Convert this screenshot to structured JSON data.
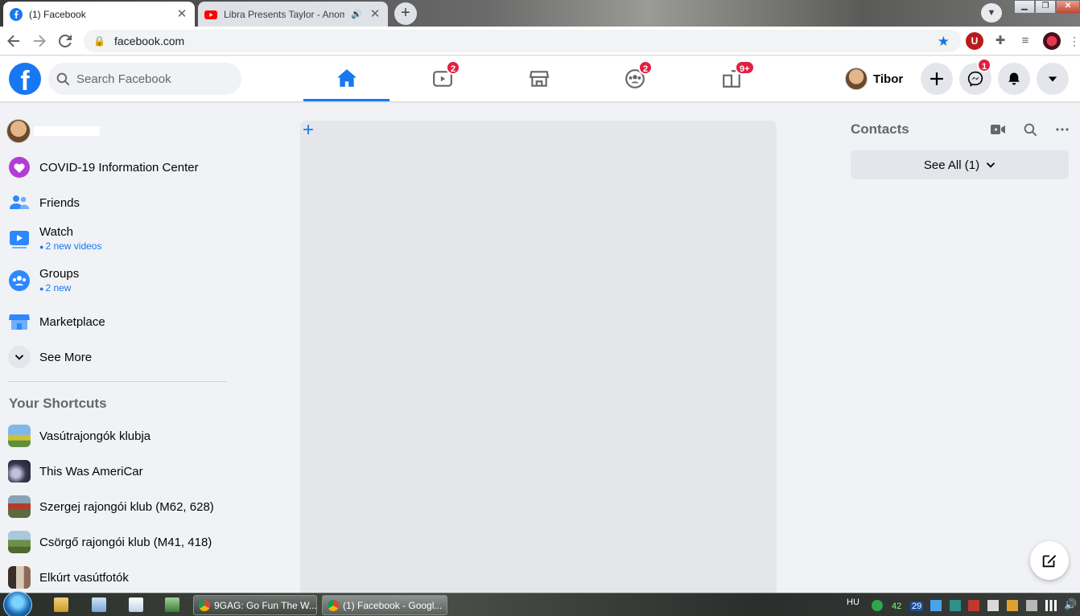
{
  "browser": {
    "tabs": [
      {
        "title": "(1) Facebook",
        "icon": "facebook-icon"
      },
      {
        "title": "Libra Presents Taylor - Anom",
        "icon": "youtube-icon"
      }
    ],
    "url": "facebook.com",
    "accent": "#1a73e8"
  },
  "header": {
    "search_placeholder": "Search Facebook",
    "nav": [
      {
        "name": "home",
        "badge": ""
      },
      {
        "name": "watch",
        "badge": "2"
      },
      {
        "name": "marketplace",
        "badge": ""
      },
      {
        "name": "groups",
        "badge": "2"
      },
      {
        "name": "gaming",
        "badge": "9+"
      }
    ],
    "profile_name": "Tibor",
    "messenger_badge": "1",
    "brand_color": "#1877f2",
    "badge_color": "#e41e3f"
  },
  "sidebar": {
    "items": [
      {
        "label": "COVID-19 Information Center",
        "sub": ""
      },
      {
        "label": "Friends",
        "sub": ""
      },
      {
        "label": "Watch",
        "sub": "2 new videos"
      },
      {
        "label": "Groups",
        "sub": "2 new"
      },
      {
        "label": "Marketplace",
        "sub": ""
      },
      {
        "label": "See More",
        "sub": ""
      }
    ],
    "shortcuts_title": "Your Shortcuts",
    "shortcuts": [
      "Vasútrajongók klubja",
      "This Was AmeriCar",
      "Szergej rajongói klub (M62, 628)",
      "Csörgő rajongói klub (M41, 418)",
      "Elkúrt vasútfotók"
    ]
  },
  "contacts": {
    "title": "Contacts",
    "see_all": "See All (1)"
  },
  "taskbar": {
    "items": [
      "9GAG: Go Fun The W...",
      "(1) Facebook - Googl..."
    ],
    "lang": "HU",
    "tray_a": "42",
    "tray_b": "29"
  }
}
